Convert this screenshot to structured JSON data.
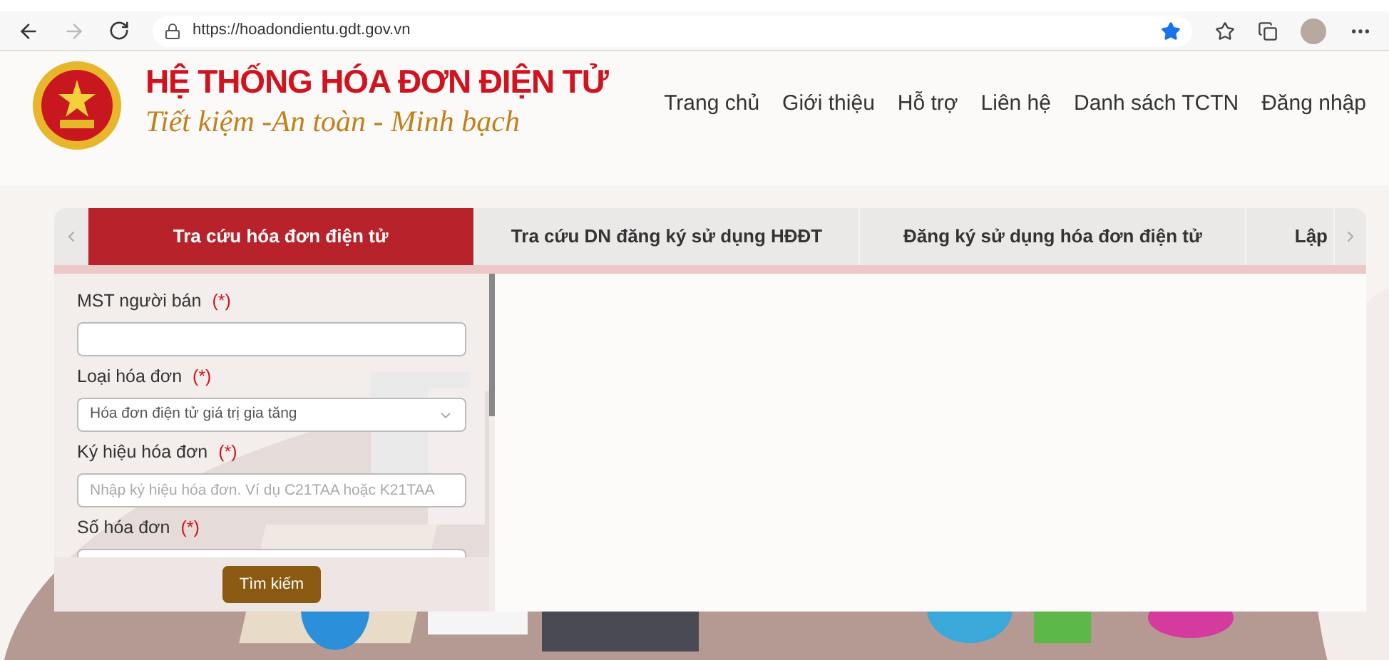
{
  "browser": {
    "url": "https://hoadondientu.gdt.gov.vn"
  },
  "header": {
    "title": "HỆ THỐNG HÓA ĐƠN ĐIỆN TỬ",
    "subtitle": "Tiết kiệm -An toàn - Minh bạch",
    "nav": [
      {
        "label": "Trang chủ"
      },
      {
        "label": "Giới thiệu"
      },
      {
        "label": "Hỗ trợ"
      },
      {
        "label": "Liên hệ"
      },
      {
        "label": "Danh sách TCTN"
      },
      {
        "label": "Đăng nhập"
      }
    ]
  },
  "tabs": [
    {
      "label": "Tra cứu hóa đơn điện tử",
      "selected": true
    },
    {
      "label": "Tra cứu DN đăng ký sử dụng HĐĐT",
      "selected": false
    },
    {
      "label": "Đăng ký sử dụng hóa đơn điện tử",
      "selected": false
    },
    {
      "label": "Lập",
      "selected": false
    }
  ],
  "form": {
    "fields": [
      {
        "kind": "text",
        "label": "MST người bán",
        "required": "(*)"
      },
      {
        "kind": "select",
        "label": "Loại hóa đơn",
        "required": "(*)",
        "value": "Hóa đơn điện tử giá trị gia tăng"
      },
      {
        "kind": "text",
        "label": "Ký hiệu hóa đơn",
        "required": "(*)",
        "placeholder": "Nhập ký hiệu hóa đơn. Ví dụ C21TAA hoặc K21TAA"
      },
      {
        "kind": "text",
        "label": "Số hóa đơn",
        "required": "(*)"
      }
    ],
    "submit": "Tìm kiếm"
  }
}
